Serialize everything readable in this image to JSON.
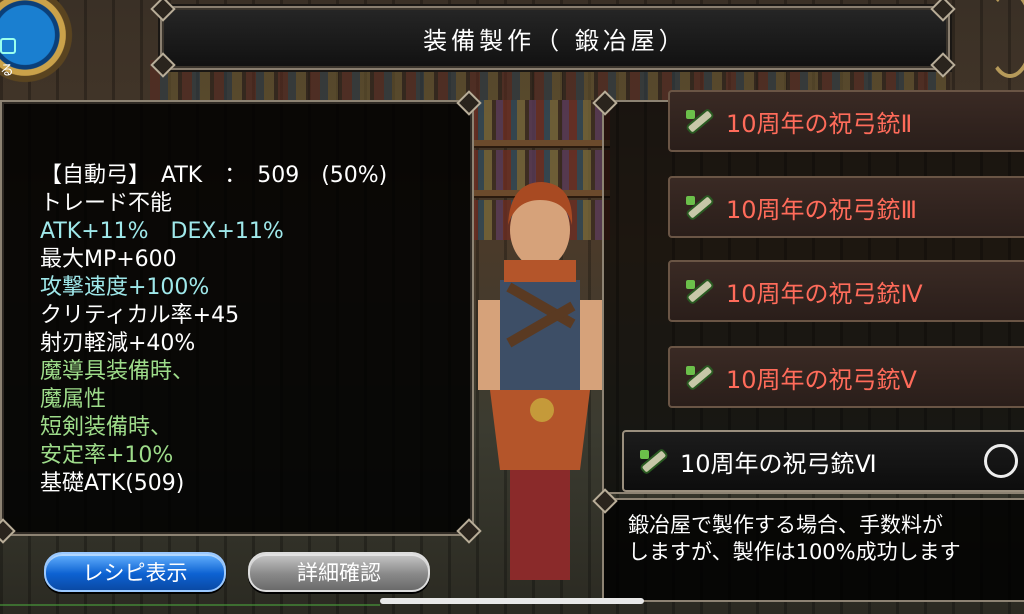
{
  "title": "装備製作（ 鍛冶屋）",
  "corner_button_label": "る",
  "item_stats": [
    {
      "text": "【自動弓】　ATK　：　509　(50%)",
      "color": "white"
    },
    {
      "text": "トレード不能",
      "color": "white"
    },
    {
      "text": "ATK+11%　DEX+11%",
      "color": "cyan"
    },
    {
      "text": "最大MP+600",
      "color": "white"
    },
    {
      "text": "攻撃速度+100%",
      "color": "cyan"
    },
    {
      "text": "クリティカル率+45",
      "color": "white"
    },
    {
      "text": "射刃軽減+40%",
      "color": "white"
    },
    {
      "text": "魔導具装備時、",
      "color": "green"
    },
    {
      "text": "魔属性",
      "color": "green"
    },
    {
      "text": "短剣装備時、",
      "color": "green"
    },
    {
      "text": "安定率+10%",
      "color": "green"
    },
    {
      "text": "基礎ATK(509)",
      "color": "white"
    }
  ],
  "recipes": [
    {
      "label": "10周年の祝弓銃Ⅱ",
      "selected": false
    },
    {
      "label": "10周年の祝弓銃Ⅲ",
      "selected": false
    },
    {
      "label": "10周年の祝弓銃Ⅳ",
      "selected": false
    },
    {
      "label": "10周年の祝弓銃Ⅴ",
      "selected": false
    },
    {
      "label": "10周年の祝弓銃Ⅵ",
      "selected": true
    }
  ],
  "description": "鍛冶屋で製作する場合、手数料が\nしますが、製作は100%成功します",
  "buttons": {
    "recipe_display": "レシピ表示",
    "detail_confirm": "詳細確認"
  },
  "icons": {
    "recipe_icon": "crossbow-gun-icon",
    "radio_icon": "radio-circle-icon"
  },
  "colors": {
    "recipe_text": "#ff6b5a",
    "stat_cyan": "#9fe8ea",
    "stat_green": "#9edc8a",
    "button_blue": "#0d62d2"
  }
}
